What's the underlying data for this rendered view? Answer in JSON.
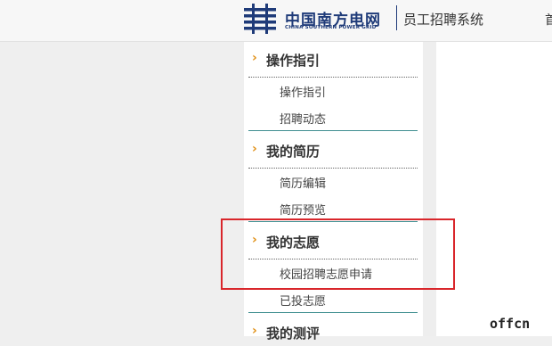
{
  "header": {
    "logo_cn": "中国南方电网",
    "logo_en": "CHINA SOUTHERN POWER GRID",
    "system_title": "员工招聘系统",
    "edge_text": "首"
  },
  "sidebar": {
    "sections": [
      {
        "title": "操作指引",
        "items": [
          "操作指引",
          "招聘动态"
        ]
      },
      {
        "title": "我的简历",
        "items": [
          "简历编辑",
          "简历预览"
        ]
      },
      {
        "title": "我的志愿",
        "items": [
          "校园招聘志愿申请",
          "已投志愿"
        ]
      },
      {
        "title": "我的测评",
        "items": []
      }
    ]
  },
  "watermark": "offcn",
  "colors": {
    "brand_blue": "#1f3b79",
    "arrow_orange": "#e08f14",
    "highlight_red": "#d9262b",
    "divider_teal": "#3f8e90"
  }
}
